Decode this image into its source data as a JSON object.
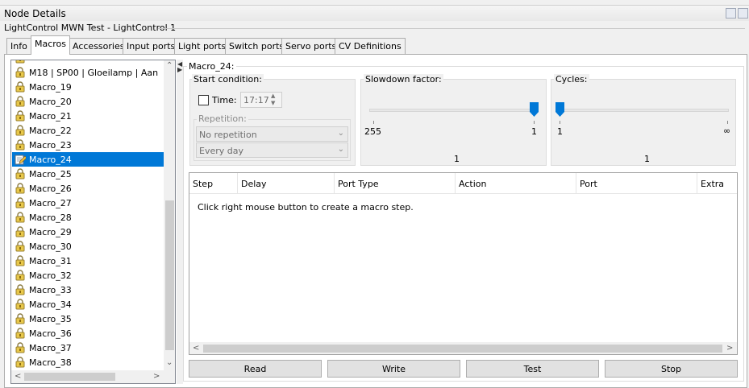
{
  "window": {
    "title": "Node Details",
    "group_caption": "LightControl MWN Test - LightControl 1"
  },
  "tabs": [
    "Info",
    "Macros",
    "Accessories",
    "Input ports",
    "Light ports",
    "Switch ports",
    "Servo ports",
    "CV Definitions"
  ],
  "macro_list": {
    "items": [
      "M18 | SP00 | Gloeilamp | Aan",
      "Macro_19",
      "Macro_20",
      "Macro_21",
      "Macro_22",
      "Macro_23",
      "Macro_24",
      "Macro_25",
      "Macro_26",
      "Macro_27",
      "Macro_28",
      "Macro_29",
      "Macro_30",
      "Macro_31",
      "Macro_32",
      "Macro_33",
      "Macro_34",
      "Macro_35",
      "Macro_36",
      "Macro_37",
      "Macro_38"
    ],
    "selected": "Macro_24"
  },
  "macro": {
    "title": "Macro_24:",
    "start_condition": {
      "title": "Start condition:",
      "time_label": "Time:",
      "time_value": "17:17",
      "repetition_title": "Repetition:",
      "repetition_value": "No repetition",
      "day_value": "Every day"
    },
    "slowdown": {
      "title": "Slowdown factor:",
      "min_label": "255",
      "max_label": "1",
      "value": "1"
    },
    "cycles": {
      "title": "Cycles:",
      "min_label": "1",
      "max_label": "∞",
      "value": "1"
    },
    "grid": {
      "columns": [
        "Step",
        "Delay",
        "Port Type",
        "Action",
        "Port",
        "Extra"
      ],
      "hint": "Click right mouse button to create a macro step."
    }
  },
  "buttons": {
    "read": "Read",
    "write": "Write",
    "test": "Test",
    "stop": "Stop"
  },
  "colors": {
    "selection": "#0078d7",
    "slider_thumb": "#0078d7"
  }
}
